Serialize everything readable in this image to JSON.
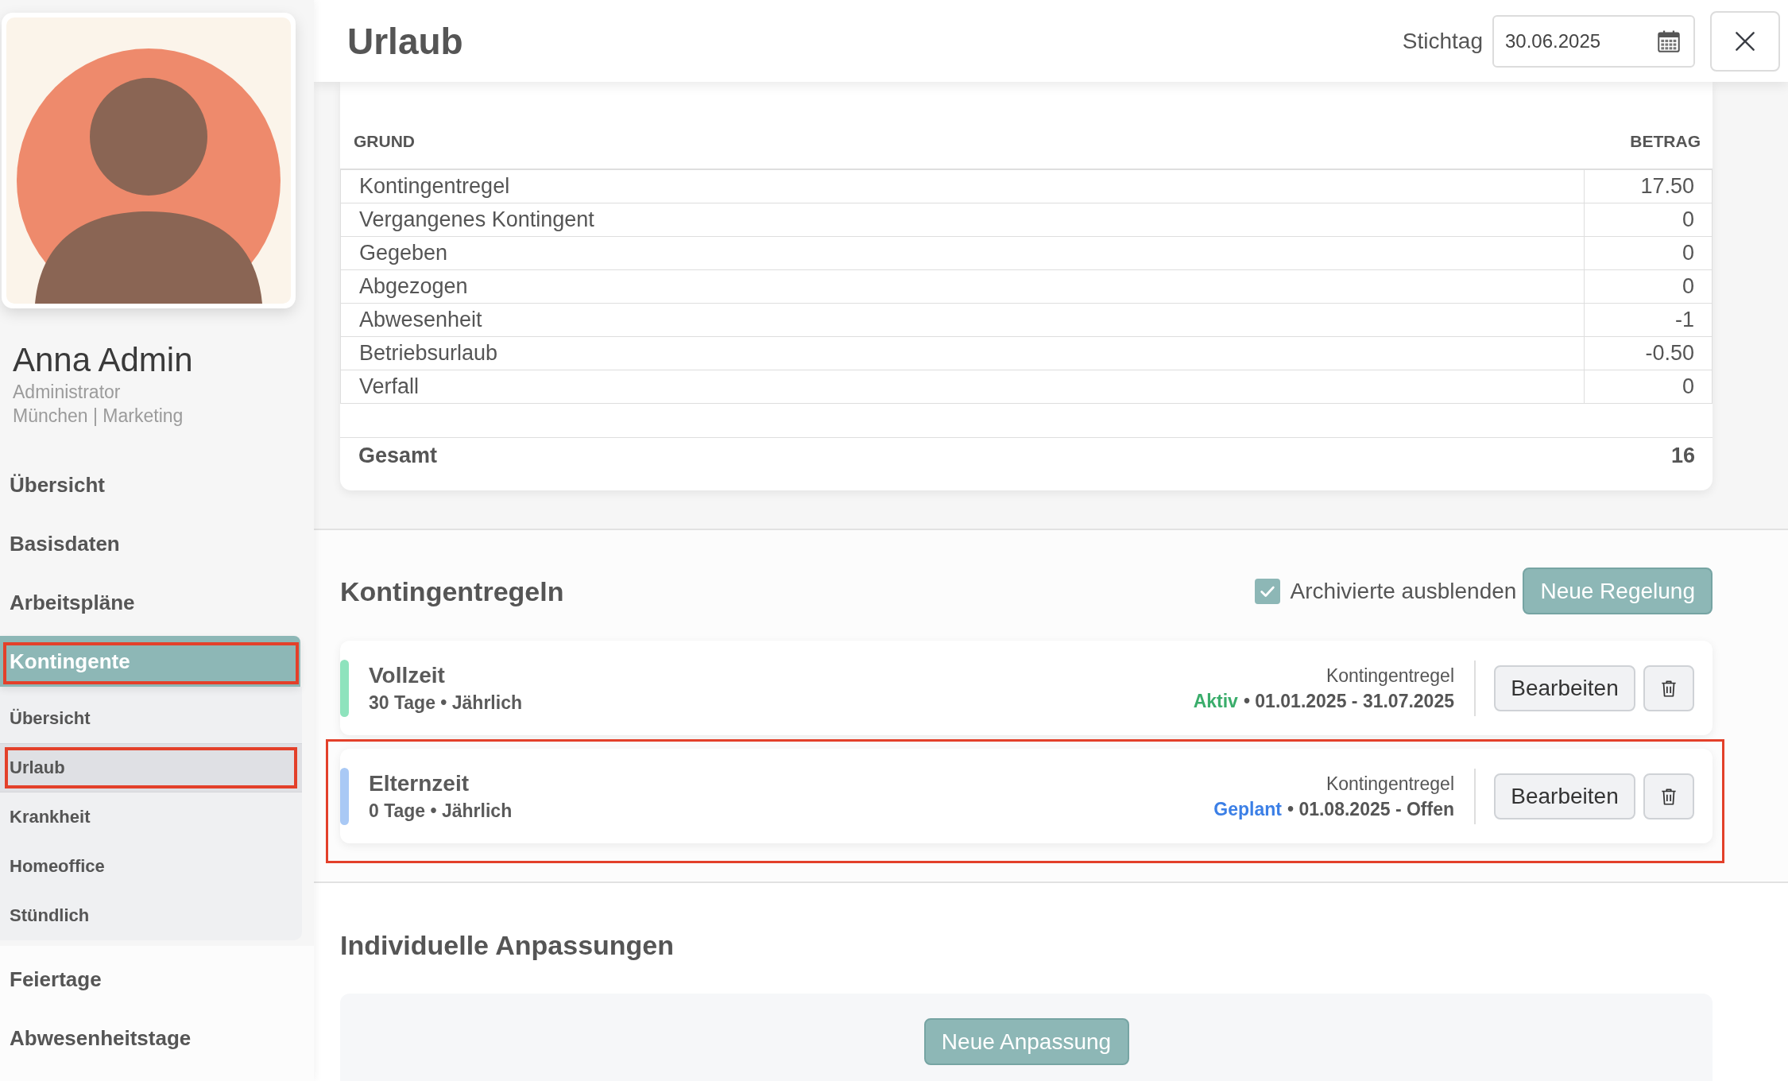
{
  "sidebar": {
    "profile": {
      "name": "Anna Admin",
      "role": "Administrator",
      "location": "München | Marketing"
    },
    "nav": [
      {
        "label": "Übersicht",
        "selected": false,
        "marked": false
      },
      {
        "label": "Basisdaten",
        "selected": false,
        "marked": false
      },
      {
        "label": "Arbeitspläne",
        "selected": false,
        "marked": false
      },
      {
        "label": "Kontingente",
        "selected": true,
        "marked": true,
        "children": [
          {
            "label": "Übersicht",
            "selected": false,
            "marked": false
          },
          {
            "label": "Urlaub",
            "selected": true,
            "marked": true
          },
          {
            "label": "Krankheit",
            "selected": false,
            "marked": false
          },
          {
            "label": "Homeoffice",
            "selected": false,
            "marked": false
          },
          {
            "label": "Stündlich",
            "selected": false,
            "marked": false
          }
        ]
      },
      {
        "label": "Feiertage",
        "selected": false,
        "marked": false
      },
      {
        "label": "Abwesenheitstage",
        "selected": false,
        "marked": false
      }
    ]
  },
  "header": {
    "title": "Urlaub",
    "date_label": "Stichtag",
    "date_value": "30.06.2025"
  },
  "composition": {
    "columns": [
      "GRUND",
      "BETRAG"
    ],
    "rows": [
      {
        "reason": "Kontingentregel",
        "amount": "17.50"
      },
      {
        "reason": "Vergangenes Kontingent",
        "amount": "0"
      },
      {
        "reason": "Gegeben",
        "amount": "0"
      },
      {
        "reason": "Abgezogen",
        "amount": "0"
      },
      {
        "reason": "Abwesenheit",
        "amount": "-1"
      },
      {
        "reason": "Betriebsurlaub",
        "amount": "-0.50"
      },
      {
        "reason": "Verfall",
        "amount": "0"
      }
    ],
    "total": {
      "label": "Gesamt",
      "amount": "16"
    }
  },
  "rules": {
    "title": "Kontingentregeln",
    "hide_archived": {
      "label": "Archivierte ausblenden",
      "checked": true
    },
    "new_button": "Neue Regelung",
    "items": [
      {
        "kind": "active",
        "name": "Vollzeit",
        "details": "30 Tage • Jährlich",
        "type_label": "Kontingentregel",
        "status": "Aktiv",
        "period": "• 01.01.2025 - 31.07.2025",
        "color": "#8ee3bd",
        "edit_button": "Bearbeiten",
        "marked": false
      },
      {
        "kind": "planned",
        "name": "Elternzeit",
        "details": "0 Tage • Jährlich",
        "type_label": "Kontingentregel",
        "status": "Geplant",
        "period": "• 01.08.2025 - Offen",
        "color": "#a9c9f5",
        "edit_button": "Bearbeiten",
        "marked": true
      }
    ]
  },
  "adjustments": {
    "title": "Individuelle Anpassungen",
    "new_button": "Neue Anpassung"
  }
}
